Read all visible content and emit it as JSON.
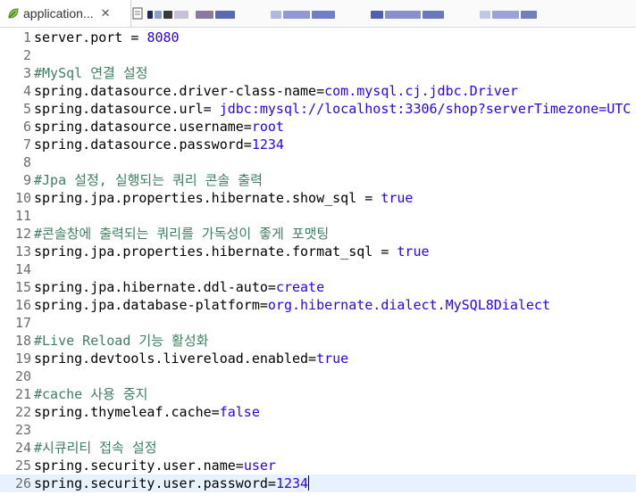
{
  "tabs": [
    {
      "label": "application...",
      "close": "✕",
      "icon": "properties-leaf-icon",
      "active": true
    },
    {
      "label": "",
      "icon": "java-file-icon",
      "active": false
    }
  ],
  "colors": {
    "key": "#000000",
    "value": "#2a00ff",
    "comment": "#3f7f5f",
    "current_line": "#e8f2fe"
  },
  "editor": {
    "lines": [
      {
        "num": "1",
        "key": "server.port = ",
        "value": "8080",
        "type": "kv"
      },
      {
        "num": "2",
        "key": "",
        "value": "",
        "type": "blank"
      },
      {
        "num": "3",
        "comment": "#MySql 연결 설정",
        "type": "comment"
      },
      {
        "num": "4",
        "key": "spring.datasource.driver-class-name=",
        "value": "com.mysql.cj.jdbc.Driver",
        "type": "kv"
      },
      {
        "num": "5",
        "key": "spring.datasource.url= ",
        "value": "jdbc:mysql://localhost:3306/shop?serverTimezone=UTC",
        "type": "kv"
      },
      {
        "num": "6",
        "key": "spring.datasource.username=",
        "value": "root",
        "type": "kv"
      },
      {
        "num": "7",
        "key": "spring.datasource.password=",
        "value": "1234",
        "type": "kv"
      },
      {
        "num": "8",
        "key": "",
        "value": "",
        "type": "blank"
      },
      {
        "num": "9",
        "comment": "#Jpa 설정, 실행되는 쿼리 콘솔 출력",
        "type": "comment"
      },
      {
        "num": "10",
        "key": "spring.jpa.properties.hibernate.show_sql = ",
        "value": "true",
        "type": "kv"
      },
      {
        "num": "11",
        "key": "",
        "value": "",
        "type": "blank"
      },
      {
        "num": "12",
        "comment": "#콘솔창에 출력되는 쿼리를 가독성이 좋게 포맷팅",
        "type": "comment"
      },
      {
        "num": "13",
        "key": "spring.jpa.properties.hibernate.format_sql = ",
        "value": "true",
        "type": "kv"
      },
      {
        "num": "14",
        "key": "",
        "value": "",
        "type": "blank"
      },
      {
        "num": "15",
        "key": "spring.jpa.hibernate.ddl-auto=",
        "value": "create",
        "type": "kv"
      },
      {
        "num": "16",
        "key": "spring.jpa.database-platform=",
        "value": "org.hibernate.dialect.MySQL8Dialect",
        "type": "kv"
      },
      {
        "num": "17",
        "key": "",
        "value": "",
        "type": "blank"
      },
      {
        "num": "18",
        "comment": "#Live Reload 기능 활성화",
        "type": "comment"
      },
      {
        "num": "19",
        "key": "spring.devtools.livereload.enabled=",
        "value": "true",
        "type": "kv"
      },
      {
        "num": "20",
        "key": "",
        "value": "",
        "type": "blank"
      },
      {
        "num": "21",
        "comment": "#cache 사용 중지",
        "type": "comment"
      },
      {
        "num": "22",
        "key": "spring.thymeleaf.cache=",
        "value": "false",
        "type": "kv"
      },
      {
        "num": "23",
        "key": "",
        "value": "",
        "type": "blank"
      },
      {
        "num": "24",
        "comment": "#시큐리티 접속 설정",
        "type": "comment"
      },
      {
        "num": "25",
        "key": "spring.security.user.name=",
        "value": "user",
        "type": "kv"
      },
      {
        "num": "26",
        "key": "spring.security.user.password=",
        "value": "1234",
        "type": "kv",
        "current": true
      }
    ]
  }
}
